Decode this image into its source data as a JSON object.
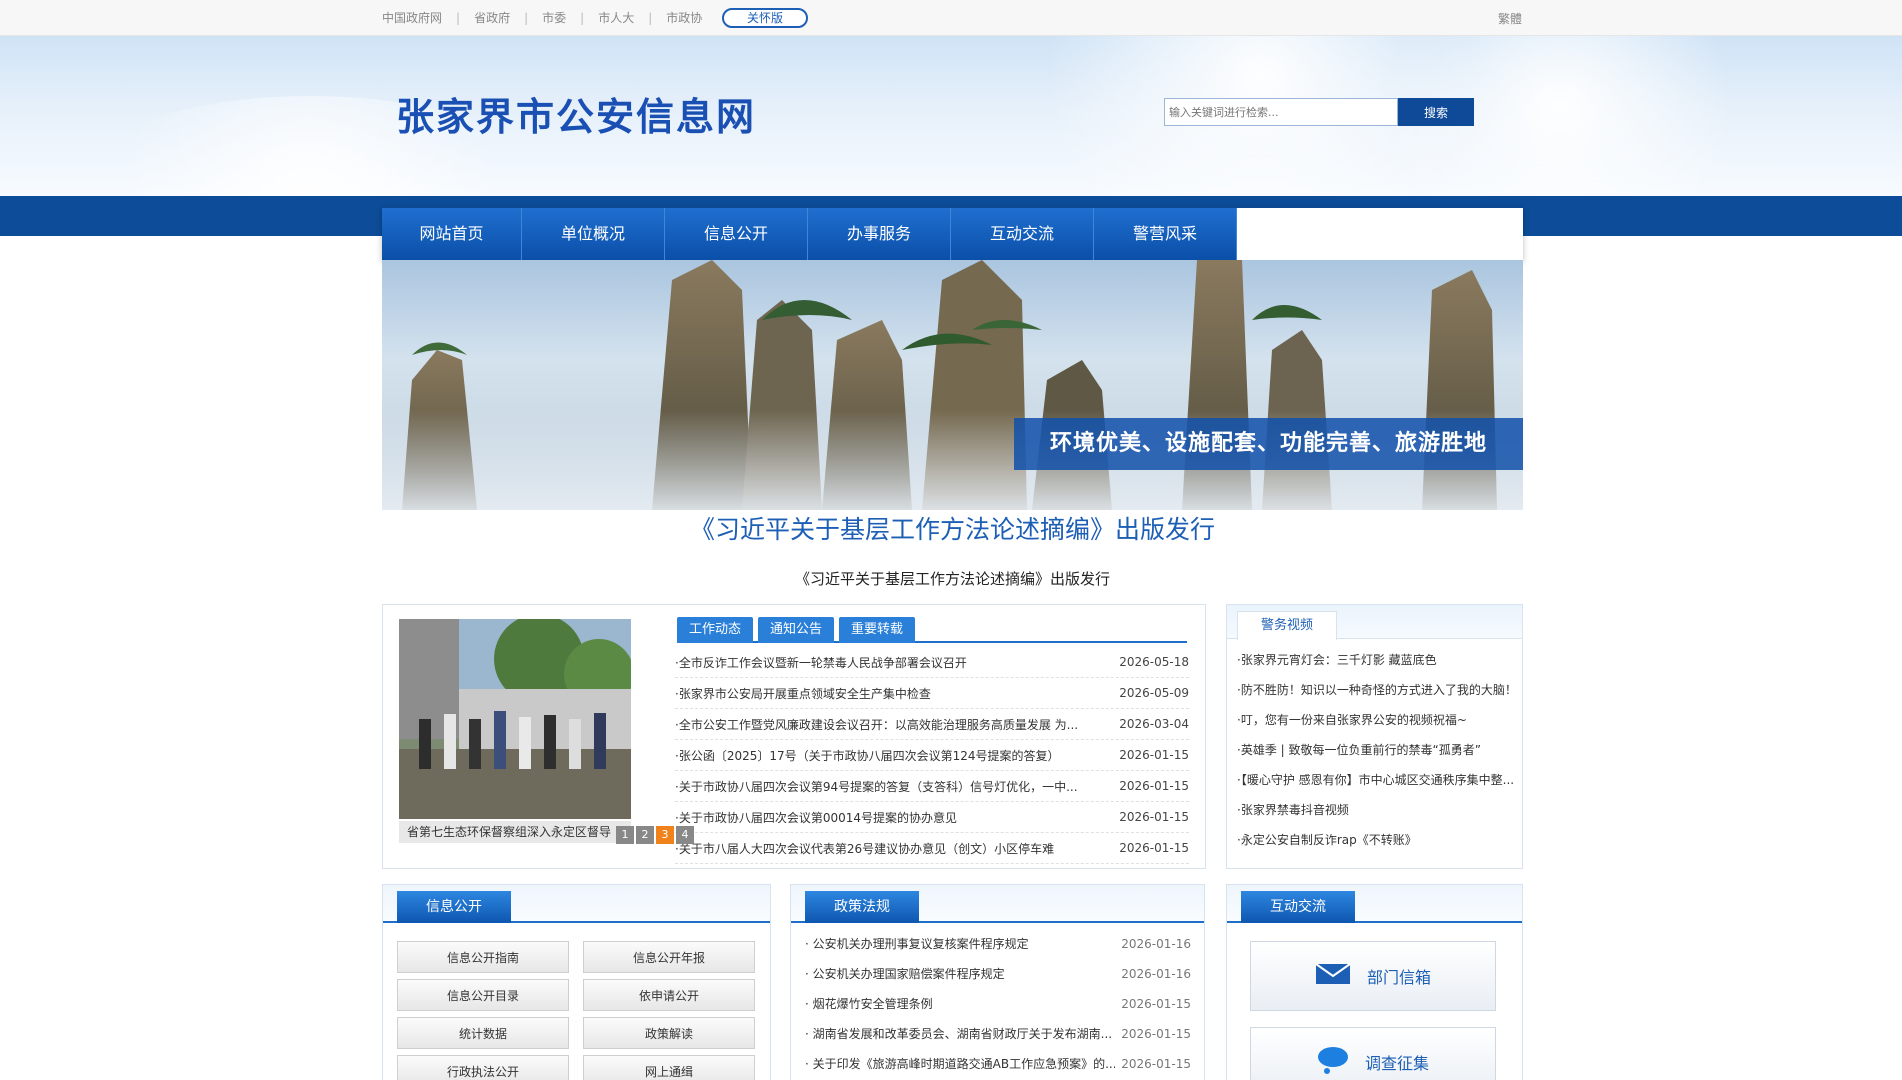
{
  "topbar": {
    "links": [
      "中国政府网",
      "省政府",
      "市委",
      "市人大",
      "市政协"
    ],
    "care_label": "关怀版",
    "traditional_label": "繁體"
  },
  "header": {
    "site_title": "张家界市公安信息网",
    "search_placeholder": "输入关键词进行检索...",
    "search_button": "搜索"
  },
  "nav": {
    "items": [
      "网站首页",
      "单位概况",
      "信息公开",
      "办事服务",
      "互动交流",
      "警营风采"
    ]
  },
  "banner": {
    "slogan": "环境优美、设施配套、功能完善、旅游胜地"
  },
  "headline": {
    "title": "《习近平关于基层工作方法论述摘编》出版发行",
    "subtitle": "《习近平关于基层工作方法论述摘编》出版发行"
  },
  "news": {
    "photo_caption": "省第七生态环保督察组深入永定区督导",
    "pager": [
      "1",
      "2",
      "3",
      "4"
    ],
    "pager_active": "3",
    "tabs": [
      "工作动态",
      "通知公告",
      "重要转载"
    ],
    "items": [
      {
        "title": "·全市反诈工作会议暨新一轮禁毒人民战争部署会议召开",
        "date": "2026-05-18"
      },
      {
        "title": "·张家界市公安局开展重点领域安全生产集中检查",
        "date": "2026-05-09"
      },
      {
        "title": "·全市公安工作暨党风廉政建设会议召开：以高效能治理服务高质量发展 为...",
        "date": "2026-03-04"
      },
      {
        "title": "·张公函〔2025〕17号（关于市政协八届四次会议第124号提案的答复）",
        "date": "2026-01-15"
      },
      {
        "title": "·关于市政协八届四次会议第94号提案的答复（支答科）信号灯优化，一中...",
        "date": "2026-01-15"
      },
      {
        "title": "·关于市政协八届四次会议第00014号提案的协办意见",
        "date": "2026-01-15"
      },
      {
        "title": "·关于市八届人大四次会议代表第26号建议协办意见（创文）小区停车难",
        "date": "2026-01-15"
      }
    ]
  },
  "video": {
    "tab": "警务视频",
    "items": [
      "·张家界元宵灯会：三千灯影 藏蓝底色",
      "·防不胜防！知识以一种奇怪的方式进入了我的大脑！",
      "·叮，您有一份来自张家界公安的视频祝福~",
      "·英雄季 | 致敬每一位负重前行的禁毒“孤勇者”",
      "·【暖心守护 感恩有你】市中心城区交通秩序集中整...",
      "·张家界禁毒抖音视频",
      "·永定公安自制反诈rap《不转账》"
    ]
  },
  "info": {
    "tab": "信息公开",
    "buttons": [
      "信息公开指南",
      "信息公开年报",
      "信息公开目录",
      "依申请公开",
      "统计数据",
      "政策解读",
      "行政执法公开",
      "网上通缉"
    ]
  },
  "law": {
    "tab": "政策法规",
    "items": [
      {
        "title": "· 公安机关办理刑事复议复核案件程序规定",
        "date": "2026-01-16"
      },
      {
        "title": "· 公安机关办理国家赔偿案件程序规定",
        "date": "2026-01-16"
      },
      {
        "title": "· 烟花爆竹安全管理条例",
        "date": "2026-01-15"
      },
      {
        "title": "· 湖南省发展和改革委员会、湖南省财政厅关于发布湖南...",
        "date": "2026-01-15"
      },
      {
        "title": "· 关于印发《旅游高峰时期道路交通AB工作应急预案》的...",
        "date": "2026-01-15"
      }
    ]
  },
  "interact": {
    "tab": "互动交流",
    "items": [
      {
        "label": "部门信箱",
        "icon": "envelope-icon"
      },
      {
        "label": "调查征集",
        "icon": "chat-bubble-icon"
      }
    ]
  },
  "colors": {
    "primary_blue": "#0c4c98",
    "title_blue": "#1a4fb3",
    "accent_orange": "#f0821c"
  }
}
